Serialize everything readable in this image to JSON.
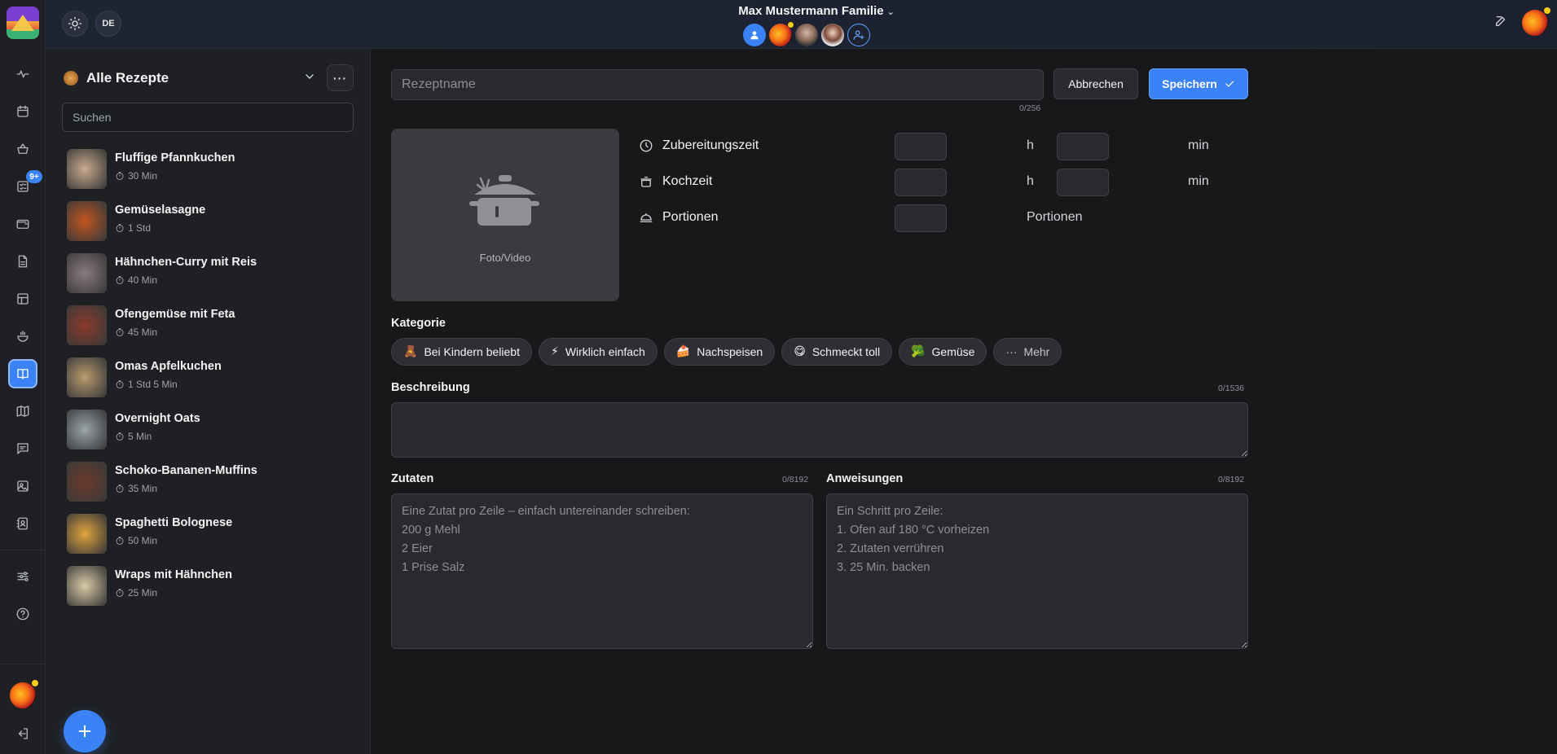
{
  "topbar": {
    "lang_label": "DE",
    "family_name": "Max Mustermann Familie",
    "members": [
      "me",
      "fruit",
      "person-1",
      "person-2"
    ]
  },
  "rail": {
    "badge": "9+",
    "items": [
      "activity",
      "calendar",
      "shopping-basket",
      "checklist",
      "wallet",
      "document",
      "table",
      "cooking",
      "recipes",
      "map",
      "chat",
      "photos",
      "contacts"
    ],
    "active": "recipes"
  },
  "list": {
    "title": "Alle Rezepte",
    "search_placeholder": "Suchen",
    "recipes": [
      {
        "name": "Fluffige Pfannkuchen",
        "time": "30 Min",
        "color": "#c9a98b"
      },
      {
        "name": "Gemüselasagne",
        "time": "1 Std",
        "color": "#c2541f"
      },
      {
        "name": "Hähnchen-Curry mit Reis",
        "time": "40 Min",
        "color": "#8a7a7d"
      },
      {
        "name": "Ofengemüse mit Feta",
        "time": "45 Min",
        "color": "#8c3a2b"
      },
      {
        "name": "Omas Apfelkuchen",
        "time": "1 Std 5 Min",
        "color": "#b99a6e"
      },
      {
        "name": "Overnight Oats",
        "time": "5 Min",
        "color": "#9aa3a8"
      },
      {
        "name": "Schoko-Bananen-Muffins",
        "time": "35 Min",
        "color": "#6b3a2a"
      },
      {
        "name": "Spaghetti Bolognese",
        "time": "50 Min",
        "color": "#e0a33a"
      },
      {
        "name": "Wraps mit Hähnchen",
        "time": "25 Min",
        "color": "#d9c9a4"
      }
    ]
  },
  "editor": {
    "name_placeholder": "Rezeptname",
    "name_counter": "0/256",
    "cancel_label": "Abbrechen",
    "save_label": "Speichern",
    "media_label": "Foto/Video",
    "prep_label": "Zubereitungszeit",
    "cook_label": "Kochzeit",
    "portions_label": "Portionen",
    "hour_unit": "h",
    "min_unit": "min",
    "portions_unit": "Portionen",
    "category_label": "Kategorie",
    "categories": [
      {
        "emoji": "🧸",
        "label": "Bei Kindern beliebt"
      },
      {
        "emoji": "⚡",
        "label": "Wirklich einfach"
      },
      {
        "emoji": "🍰",
        "label": "Nachspeisen"
      },
      {
        "emoji": "😋",
        "label": "Schmeckt toll"
      },
      {
        "emoji": "🥦",
        "label": "Gemüse"
      }
    ],
    "more_label": "Mehr",
    "description_label": "Beschreibung",
    "description_counter": "0/1536",
    "ingredients_label": "Zutaten",
    "ingredients_counter": "0/8192",
    "ingredients_placeholder": "Eine Zutat pro Zeile – einfach untereinander schreiben:\n200 g Mehl\n2 Eier\n1 Prise Salz",
    "instructions_label": "Anweisungen",
    "instructions_counter": "0/8192",
    "instructions_placeholder": "Ein Schritt pro Zeile:\n1. Ofen auf 180 °C vorheizen\n2. Zutaten verrühren\n3. 25 Min. backen"
  },
  "colors": {
    "accent": "#3b82f6",
    "background": "#18181b",
    "panel": "#1f2024"
  }
}
